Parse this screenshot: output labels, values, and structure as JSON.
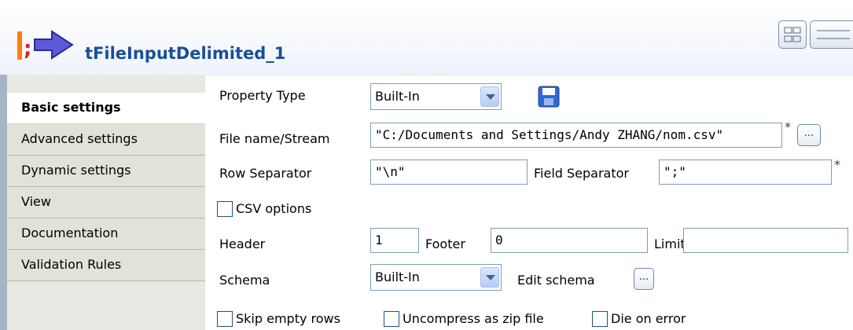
{
  "header": {
    "title": "tFileInputDelimited_1"
  },
  "tabs": [
    {
      "label": "Basic settings"
    },
    {
      "label": "Advanced settings"
    },
    {
      "label": "Dynamic settings"
    },
    {
      "label": "View"
    },
    {
      "label": "Documentation"
    },
    {
      "label": "Validation Rules"
    }
  ],
  "form": {
    "property_type": {
      "label": "Property Type",
      "value": "Built-In"
    },
    "file_name": {
      "label": "File name/Stream",
      "value": "\"C:/Documents and Settings/Andy ZHANG/nom.csv\"",
      "required_mark": "*",
      "browse_label": "..."
    },
    "row_separator": {
      "label": "Row Separator",
      "value": "\"\\n\""
    },
    "field_separator": {
      "label": "Field Separator",
      "value": "\";\"",
      "required_mark": "*"
    },
    "csv_options": {
      "label": "CSV options"
    },
    "header": {
      "label": "Header",
      "value": "1"
    },
    "footer": {
      "label": "Footer",
      "value": "0"
    },
    "limit": {
      "label": "Limit",
      "value": ""
    },
    "schema": {
      "label": "Schema",
      "value": "Built-In",
      "edit_label": "Edit schema",
      "edit_button": "..."
    },
    "skip_empty": {
      "label": "Skip empty rows"
    },
    "uncompress": {
      "label": "Uncompress as zip file"
    },
    "die_on_error": {
      "label": "Die on error"
    }
  },
  "icons": {
    "component": "component-arrow-icon",
    "save": "save-icon",
    "view1": "grid-view-icon",
    "view2": "list-view-icon"
  }
}
